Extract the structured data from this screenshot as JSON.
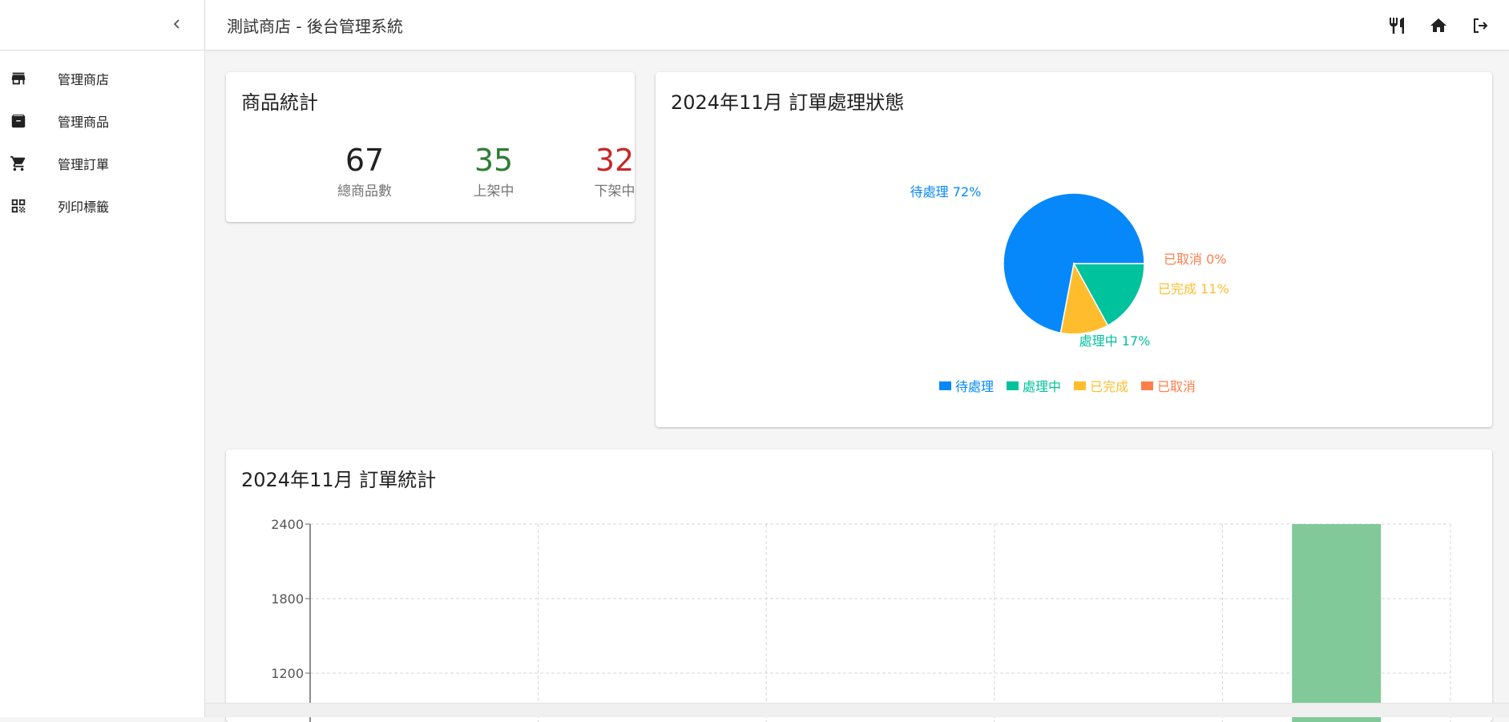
{
  "header": {
    "title": "測試商店 - 後台管理系統"
  },
  "sidebar": {
    "items": [
      {
        "label": "管理商店",
        "icon": "store-icon"
      },
      {
        "label": "管理商品",
        "icon": "archive-icon"
      },
      {
        "label": "管理訂單",
        "icon": "cart-icon"
      },
      {
        "label": "列印標籤",
        "icon": "qrcode-icon"
      }
    ]
  },
  "product_stats": {
    "title": "商品統計",
    "total": {
      "value": "67",
      "label": "總商品數",
      "color": "#212121"
    },
    "on_shelf": {
      "value": "35",
      "label": "上架中",
      "color": "#2e7d32"
    },
    "off_shelf": {
      "value": "32",
      "label": "下架中",
      "color": "#c62828"
    }
  },
  "order_status": {
    "title": "2024年11月 訂單處理狀態"
  },
  "order_stats": {
    "title": "2024年11月 訂單統計"
  },
  "chart_data": [
    {
      "type": "pie",
      "title": "2024年11月 訂單處理狀態",
      "slices": [
        {
          "name": "待處理",
          "value": 72,
          "label": "待處理 72%",
          "color": "#0688fa"
        },
        {
          "name": "處理中",
          "value": 17,
          "label": "處理中 17%",
          "color": "#00c29c"
        },
        {
          "name": "已完成",
          "value": 11,
          "label": "已完成 11%",
          "color": "#ffbd2e"
        },
        {
          "name": "已取消",
          "value": 0,
          "label": "已取消 0%",
          "color": "#ff7e4a"
        }
      ],
      "legend": [
        "待處理",
        "處理中",
        "已完成",
        "已取消"
      ],
      "legend_position": "bottom-center"
    },
    {
      "type": "bar",
      "title": "2024年11月 訂單統計",
      "yticks": [
        "2400",
        "1800",
        "1200"
      ],
      "ylim": [
        0,
        2400
      ],
      "categories": [
        "",
        "",
        "",
        "",
        ""
      ],
      "values": [
        0,
        0,
        0,
        0,
        2400
      ],
      "bar_color": "#82c99a",
      "grid": true
    }
  ]
}
